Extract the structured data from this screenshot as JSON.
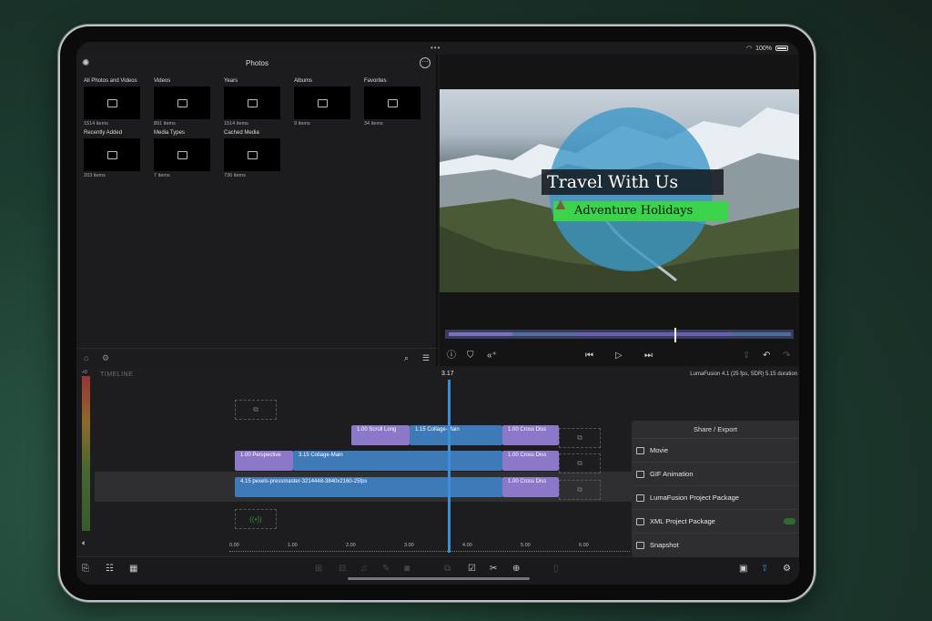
{
  "status": {
    "dots": "•••",
    "wifi_icon": "wifi-icon",
    "battery": "100%"
  },
  "photos": {
    "title": "Photos",
    "albums": [
      {
        "label": "All Photos and Videos",
        "count": "1514 items",
        "icon": "folder-icon"
      },
      {
        "label": "Videos",
        "count": "891 items",
        "icon": "video-icon"
      },
      {
        "label": "Years",
        "count": "1514 items",
        "icon": "calendar-icon"
      },
      {
        "label": "Albums",
        "count": "9 items",
        "icon": "albums-icon"
      },
      {
        "label": "Favorites",
        "count": "34 items",
        "icon": "heart-icon"
      },
      {
        "label": "Recently Added",
        "count": "203 items",
        "icon": "folder-icon"
      },
      {
        "label": "Media Types",
        "count": "7 items",
        "icon": "folder-icon"
      },
      {
        "label": "Cached Media",
        "count": "736 items",
        "icon": "bag-icon"
      }
    ]
  },
  "viewer": {
    "title_text": "Travel With Us",
    "subtitle_text": "Adventure Holidays"
  },
  "timeline": {
    "label": "TIMELINE",
    "playhead_time": "3.17",
    "project_info": "LumaFusion 4.1 (25 fps, SDR)  5.15 duration",
    "meter_label": "+0",
    "clips": {
      "scroll": "1.00  Scroll Long",
      "collage_top": "1.15  Collage-Main",
      "cross1": "1.00  Cross Diss",
      "perspective": "1.00  Perspective",
      "collage_mid": "3.15  Collage-Main",
      "cross2": "1.00  Cross Diss",
      "pexels": "4.15  pexels-pressmaster-3214448-3840x2160-25fps",
      "cross3": "1.00  Cross Diss"
    },
    "ruler": [
      "0.00",
      "1.00",
      "2.00",
      "3.00",
      "4.00",
      "5.00",
      "6.00"
    ]
  },
  "share": {
    "title": "Share / Export",
    "items": [
      "Movie",
      "GIF Animation",
      "LumaFusion Project Package",
      "XML Project Package",
      "Snapshot"
    ]
  }
}
